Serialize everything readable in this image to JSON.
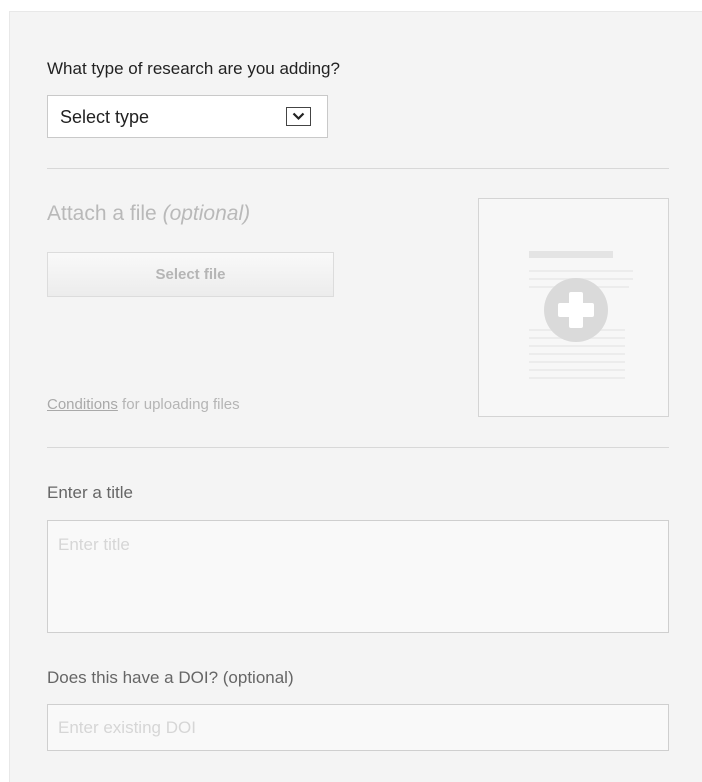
{
  "research_type": {
    "question": "What type of research are you adding?",
    "selected": "Select type",
    "arrow_icon": "chevron-down-icon"
  },
  "attach": {
    "title": "Attach a file",
    "title_suffix": "(optional)",
    "select_button": "Select file",
    "preview_icon": "document-add-icon",
    "conditions_link": "Conditions",
    "conditions_text": " for uploading files"
  },
  "title_field": {
    "label": "Enter a title",
    "placeholder": "Enter title",
    "value": ""
  },
  "doi_field": {
    "label": "Does this have a DOI? (optional)",
    "placeholder": "Enter existing DOI",
    "value": ""
  },
  "colors": {
    "panel_bg": "#f4f4f4",
    "muted_text": "#b9b9b9",
    "label_text": "#666666",
    "placeholder": "#d6d6d6"
  }
}
